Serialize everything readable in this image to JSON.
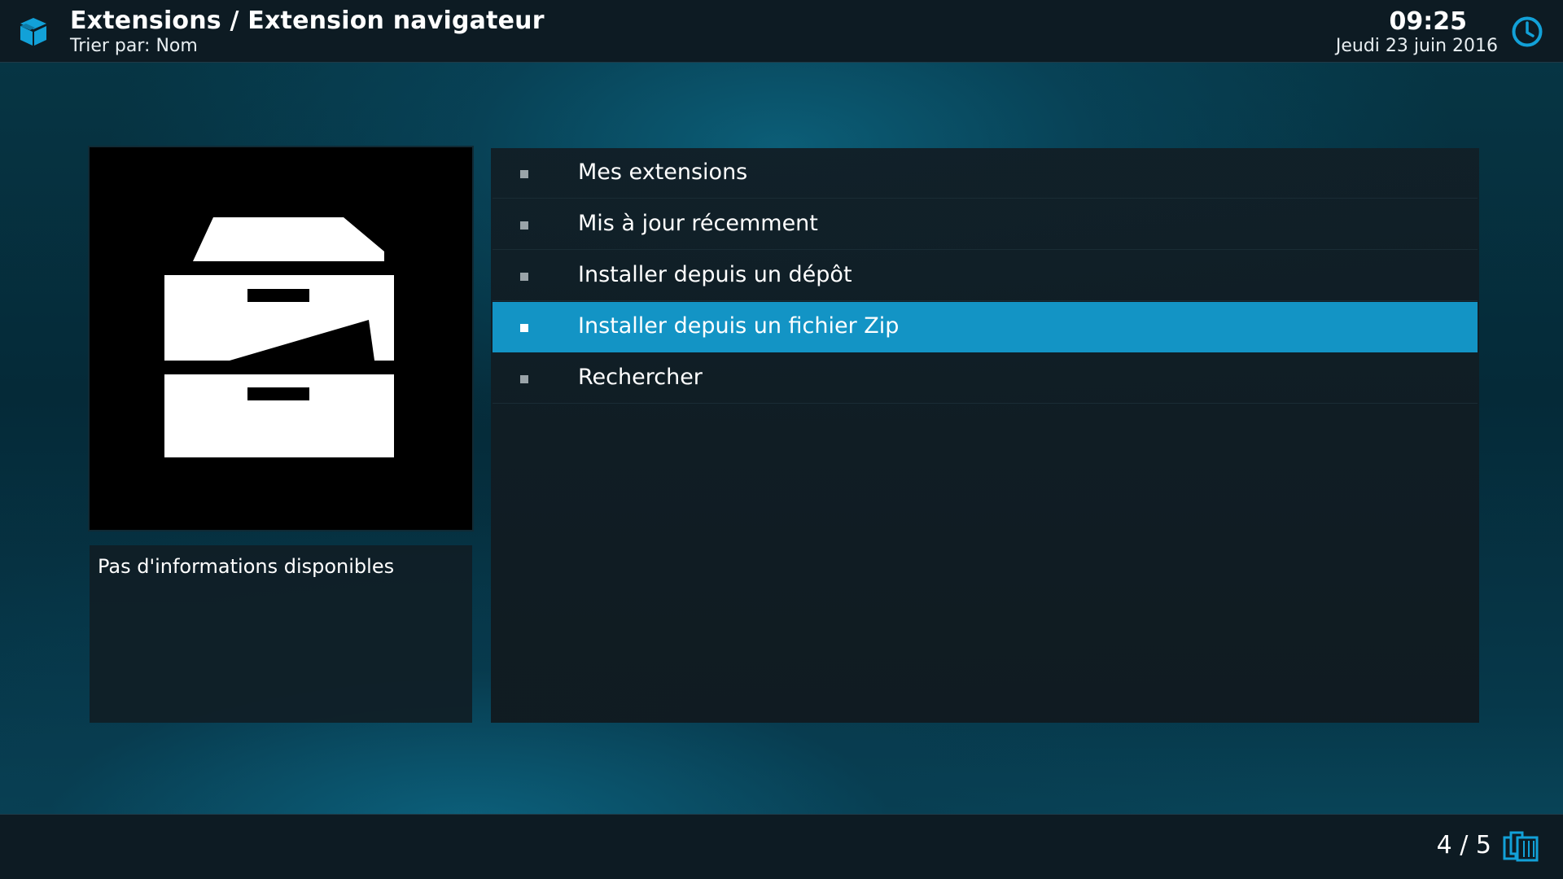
{
  "header": {
    "title": "Extensions / Extension navigateur",
    "subtitle": "Trier par: Nom",
    "time": "09:25",
    "date": "Jeudi 23 juin 2016",
    "app_icon": "open-box-icon",
    "clock_icon": "clock-icon"
  },
  "artwork": {
    "icon": "filing-cabinet-icon"
  },
  "info": {
    "text": "Pas d'informations disponibles"
  },
  "list": {
    "items": [
      {
        "label": "Mes extensions",
        "selected": false
      },
      {
        "label": "Mis à jour récemment",
        "selected": false
      },
      {
        "label": "Installer depuis un dépôt",
        "selected": false
      },
      {
        "label": "Installer depuis un fichier Zip",
        "selected": true
      },
      {
        "label": "Rechercher",
        "selected": false
      }
    ]
  },
  "footer": {
    "page_count": "4 / 5",
    "page_icon": "pages-icon"
  },
  "colors": {
    "accent": "#1394c5",
    "header_bg": "#0d1b23",
    "panel_bg": "#111f27"
  }
}
